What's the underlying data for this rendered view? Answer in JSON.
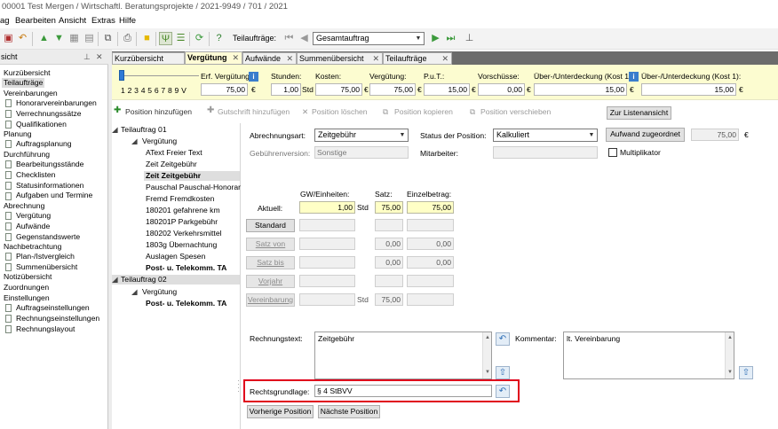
{
  "window": {
    "title": "00001 Test Mergen / Wirtschaftl. Beratungsprojekte / 2021-9949 / 701 / 2021"
  },
  "menu": [
    "ag",
    "Bearbeiten",
    "Ansicht",
    "Extras",
    "Hilfe"
  ],
  "toolbar": {
    "teilauftraege_label": "Teilaufträge:",
    "combo_value": "Gesamtauftrag"
  },
  "left_panel": {
    "header": "sicht",
    "items": [
      "Kurzübersicht",
      "Teilaufträge",
      "Vereinbarungen",
      "Honorarvereinbarungen",
      "Verrechnungssätze",
      "Qualifikationen",
      "Planung",
      "Auftragsplanung",
      "Durchführung",
      "Bearbeitungsstände",
      "Checklisten",
      "Statusinformationen",
      "Aufgaben und Termine",
      "Abrechnung",
      "Vergütung",
      "Aufwände",
      "Gegenstandswerte",
      "Nachbetrachtung",
      "Plan-/Istvergleich",
      "Summenübersicht",
      "Notizübersicht",
      "Zuordnungen",
      "Einstellungen",
      "Auftragseinstellungen",
      "Rechnungseinstellungen",
      "Rechnungslayout"
    ]
  },
  "tabs": [
    "Kurzübersicht",
    "Vergütung",
    "Aufwände",
    "Summenübersicht",
    "Teilaufträge"
  ],
  "summary": {
    "scale_label": "1 2 3 4 5 6 7 8 9 V",
    "erf_label": "Erf. Vergütung:",
    "erf_value": "75,00",
    "erf_unit": "€",
    "stunden_label": "Stunden:",
    "stunden_value": "1,00",
    "stunden_unit": "Std",
    "kosten_label": "Kosten:",
    "kosten_value": "75,00",
    "kosten_unit": "€",
    "verguetung_label": "Vergütung:",
    "verguetung_value": "75,00",
    "verguetung_unit": "€",
    "put_label": "P.u.T.:",
    "put_value": "15,00",
    "put_unit": "€",
    "vorschuesse_label": "Vorschüsse:",
    "vorschuesse_value": "0,00",
    "vorschuesse_unit": "€",
    "ueber1_label": "Über-/Unterdeckung (Kost 1)",
    "ueber1_value": "15,00",
    "ueber1_unit": "€",
    "ueber2_label": "Über-/Unterdeckung (Kost 1):",
    "ueber2_value": "15,00",
    "ueber2_unit": "€"
  },
  "actions": {
    "add_position": "Position hinzufügen",
    "add_credit": "Gutschrift hinzufügen",
    "delete_position": "Position löschen",
    "copy_position": "Position kopieren",
    "move_position": "Position verschieben",
    "list_view": "Zur Listenansicht"
  },
  "tree": {
    "items": [
      "Teilauftrag 01",
      "Vergütung",
      "AText Freier Text",
      "Zeit Zeitgebühr",
      "Zeit Zeitgebühr",
      "Pauschal Pauschal-Honorar",
      "Fremd Fremdkosten",
      "180201 gefahrene km",
      "180201P Parkgebühr",
      "180202 Verkehrsmittel",
      "1803g Übernachtung",
      "Auslagen Spesen",
      "Post- u. Telekomm. TA",
      "Teilauftrag 02",
      "Vergütung",
      "Post- u. Telekomm. TA"
    ]
  },
  "form": {
    "abrechnungsart_label": "Abrechnungsart:",
    "abrechnungsart_value": "Zeitgebühr",
    "status_label": "Status der Position:",
    "status_value": "Kalkuliert",
    "aufwand_button": "Aufwand zugeordnet",
    "aufwand_value": "75,00",
    "aufwand_unit": "€",
    "gebuehrenversion_label": "Gebührenversion:",
    "gebuehrenversion_value": "Sonstige",
    "mitarbeiter_label": "Mitarbeiter:",
    "multiplikator_label": "Multiplikator",
    "col_gw": "GW/Einheiten:",
    "col_satz": "Satz:",
    "col_einzel": "Einzelbetrag:",
    "aktuell_label": "Aktuell:",
    "aktuell_gw": "1,00",
    "aktuell_unit": "Std",
    "aktuell_satz": "75,00",
    "aktuell_einzel": "75,00",
    "standard_button": "Standard",
    "satz_von_button": "Satz von",
    "satz_bis_button": "Satz bis",
    "satz_von_value": "0,00",
    "satz_von_einzel": "0,00",
    "satz_bis_value": "0,00",
    "satz_bis_einzel": "0,00",
    "vorjahr_button": "Vorjahr",
    "vereinbarung_button": "Vereinbarung",
    "vereinbarung_unit": "Std",
    "vereinbarung_satz": "75,00",
    "rechnungstext_label": "Rechnungstext:",
    "rechnungstext_value": "Zeitgebühr",
    "kommentar_label": "Kommentar:",
    "kommentar_value": "lt. Vereinbarung",
    "rechtsgrundlage_label": "Rechtsgrundlage:",
    "rechtsgrundlage_value": "§ 4 StBVV",
    "prev_button": "Vorherige Position",
    "next_button": "Nächste Position"
  },
  "colors": {
    "highlight": "#e0001b",
    "summary_bg": "#fcfcd0",
    "active_tab_bg": "#fffbd6",
    "input_yellow": "#ffffc6"
  }
}
